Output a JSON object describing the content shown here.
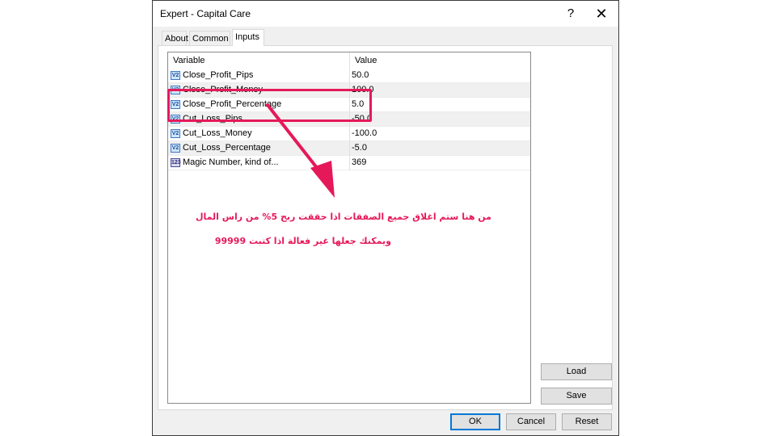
{
  "window": {
    "title": "Expert - Capital Care",
    "help_label": "?",
    "close_label": "✕"
  },
  "tabs": [
    {
      "label": "About",
      "active": false
    },
    {
      "label": "Common",
      "active": false
    },
    {
      "label": "Inputs",
      "active": true
    }
  ],
  "grid": {
    "columns": [
      "Variable",
      "Value"
    ],
    "rows": [
      {
        "icon": "V2",
        "name": "Close_Profit_Pips",
        "value": "50.0"
      },
      {
        "icon": "V2",
        "name": "Close_Profit_Money",
        "value": "100.0"
      },
      {
        "icon": "V2",
        "name": "Close_Profit_Percentage",
        "value": "5.0"
      },
      {
        "icon": "V2",
        "name": "Cut_Loss_Pips",
        "value": "-50.0"
      },
      {
        "icon": "V2",
        "name": "Cut_Loss_Money",
        "value": "-100.0"
      },
      {
        "icon": "V2",
        "name": "Cut_Loss_Percentage",
        "value": "-5.0"
      },
      {
        "icon": "123",
        "name": "Magic Number, kind of...",
        "value": "369"
      }
    ]
  },
  "side_buttons": {
    "load": "Load",
    "save": "Save"
  },
  "footer_buttons": {
    "ok": "OK",
    "cancel": "Cancel",
    "reset": "Reset"
  },
  "annotation": {
    "line1": "من هنا ستم اغلاق جميع الصفقات اذا حققت ربح 5% من راس المال",
    "line2": "ويمكنك جعلها غير فعالة اذا كتبت 99999",
    "color": "#e5195a"
  }
}
